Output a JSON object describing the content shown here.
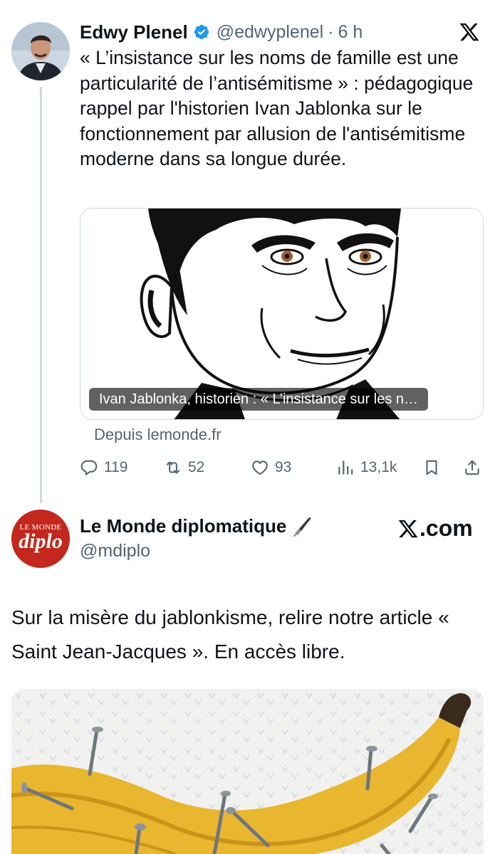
{
  "tweet1": {
    "author_name": "Edwy Plenel",
    "handle": "@edwyplenel",
    "separator": "·",
    "time": "6 h",
    "text": "« L’insistance sur les noms de famille est une particularité de l’antisémitisme » : pédagogique rappel par l'historien Ivan Jablonka sur le fonctionnement par allusion de l'antisémitisme moderne dans sa longue durée.",
    "card": {
      "caption": "Ivan Jablonka, historien : « L’insistance sur les n…",
      "source": "Depuis lemonde.fr"
    },
    "stats": {
      "replies": "119",
      "reposts": "52",
      "likes": "93",
      "views": "13,1k"
    }
  },
  "tweet2": {
    "avatar": {
      "top": "LE MONDE",
      "main": "diplo"
    },
    "author_name": "Le Monde diplomatique",
    "handle": "@mdiplo",
    "brand": ".com",
    "text": "Sur la misère du jablonkisme, relire notre article « Saint Jean-Jacques ». En accès libre."
  },
  "colors": {
    "text": "#0f1419",
    "secondary": "#536471",
    "verified": "#1d9bf0",
    "border": "#cfd9de",
    "diplo_red": "#c4271d"
  },
  "icons": {
    "close": "x-logo-icon",
    "verified": "verified-badge-icon",
    "reply": "reply-icon",
    "repost": "repost-icon",
    "like": "heart-icon",
    "views": "views-icon",
    "bookmark": "bookmark-icon",
    "share": "share-icon",
    "pen": "fountain-pen-icon"
  }
}
